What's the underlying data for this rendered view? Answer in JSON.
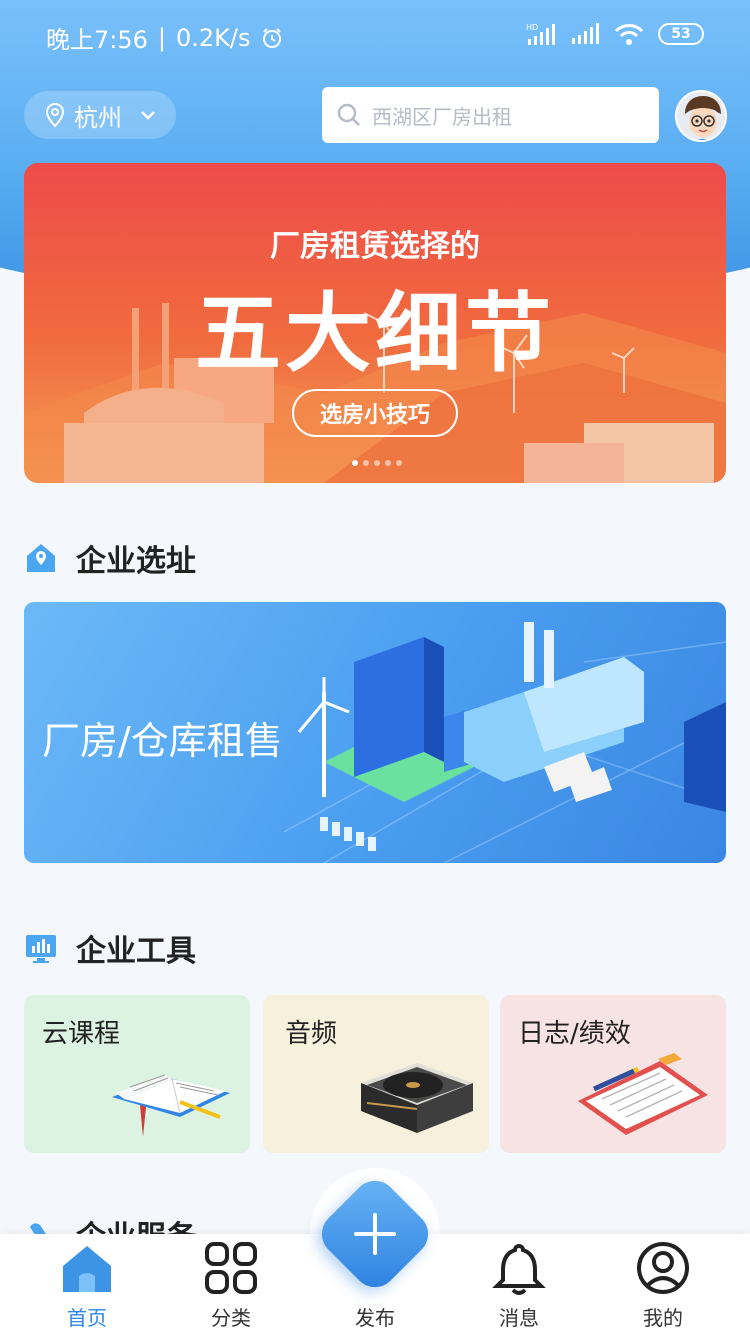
{
  "status_bar": {
    "time": "晚上7:56",
    "speed": "0.2K/s",
    "battery": "53"
  },
  "header": {
    "city": "杭州",
    "search_placeholder": "西湖区厂房出租"
  },
  "banner": {
    "subtitle": "厂房租赁选择的",
    "title": "五大细节",
    "button": "选房小技巧",
    "active_dot": 0,
    "dot_count": 5
  },
  "section_location": {
    "title": "企业选址",
    "card_text": "厂房/仓库租售"
  },
  "section_tools": {
    "title": "企业工具",
    "items": [
      {
        "label": "云课程",
        "bg": "#ddf3e2"
      },
      {
        "label": "音频",
        "bg": "#f6f0dc"
      },
      {
        "label": "日志/绩效",
        "bg": "#f7e3e4"
      }
    ]
  },
  "section_service": {
    "title": "企业服务"
  },
  "tabbar": {
    "items": [
      {
        "label": "首页",
        "icon": "home-icon"
      },
      {
        "label": "分类",
        "icon": "grid-icon"
      },
      {
        "label": "发布",
        "icon": "plus-icon"
      },
      {
        "label": "消息",
        "icon": "bell-icon"
      },
      {
        "label": "我的",
        "icon": "user-icon"
      }
    ],
    "active_index": 0
  },
  "colors": {
    "accent": "#2f86e5",
    "header_blue": "#5aaef2",
    "banner_red": "#ee4b4a"
  }
}
